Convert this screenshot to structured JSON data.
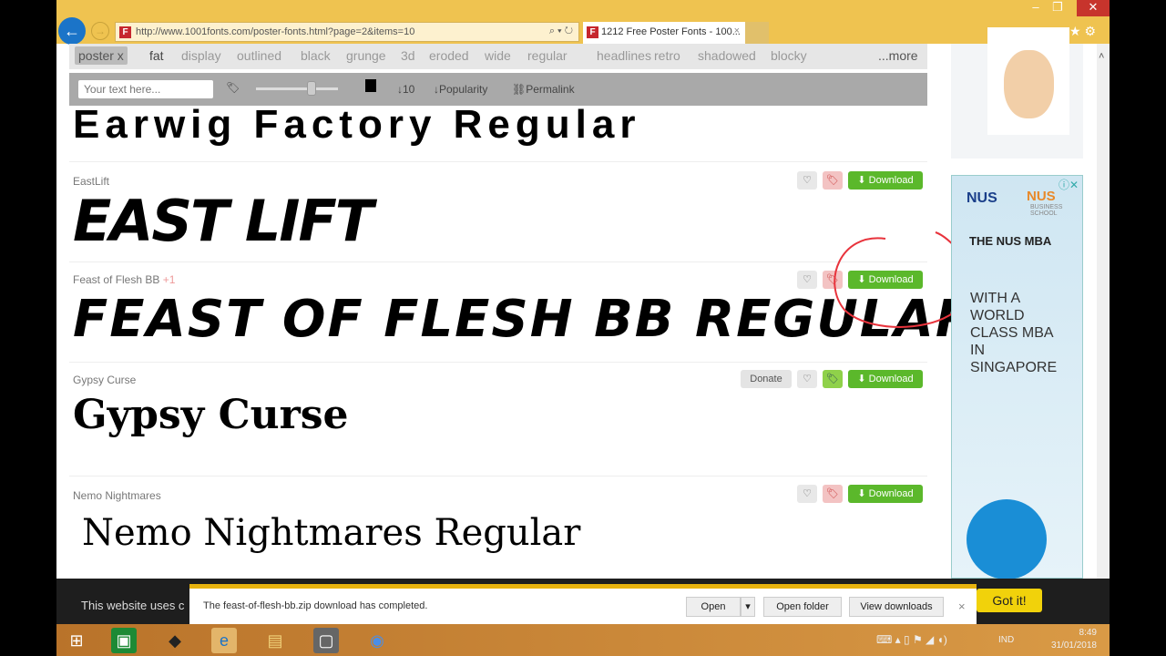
{
  "browser": {
    "url": "http://www.1001fonts.com/poster-fonts.html?page=2&items=10",
    "tab_title": "1212 Free Poster Fonts - 100...",
    "minimize": "–",
    "restore": "❐",
    "close": "✕"
  },
  "tags": {
    "active": "poster",
    "items": [
      "fat",
      "display",
      "outlined",
      "black",
      "grunge",
      "3d",
      "eroded",
      "wide",
      "regular",
      "headlines",
      "retro",
      "shadowed",
      "blocky"
    ],
    "more": "...more"
  },
  "toolbar": {
    "placeholder": "Your text here...",
    "size": "10",
    "sort": "Popularity",
    "permalink": "Permalink"
  },
  "top_preview": "Earwig Factory Regular",
  "fonts": [
    {
      "name": "EastLift",
      "preview": "EAST LIFT",
      "download": "Download"
    },
    {
      "name": "Feast of Flesh BB",
      "badge": "+1",
      "preview": "FEAST OF FLESH BB REGULAR",
      "download": "Download"
    },
    {
      "name": "Gypsy Curse",
      "preview": "Gypsy Curse",
      "donate": "Donate",
      "download": "Download"
    },
    {
      "name": "Nemo Nightmares",
      "preview": "Nemo Nightmares Regular",
      "download": "Download"
    }
  ],
  "ad": {
    "brand": "NUS",
    "school": "NUS",
    "school_sub": "BUSINESS SCHOOL",
    "title": "THE NUS MBA",
    "body": "WITH A WORLD CLASS MBA IN SINGAPORE"
  },
  "cookie": {
    "text": "This website uses c",
    "button": "Got it!"
  },
  "download_bar": {
    "message": "The feast-of-flesh-bb.zip download has completed.",
    "open": "Open",
    "open_folder": "Open folder",
    "view_downloads": "View downloads"
  },
  "taskbar": {
    "lang": "IND",
    "time": "8:49",
    "date": "31/01/2018"
  },
  "colors": {
    "accent": "#efc350",
    "download": "#5bb82b",
    "gotit": "#f1d20b"
  }
}
